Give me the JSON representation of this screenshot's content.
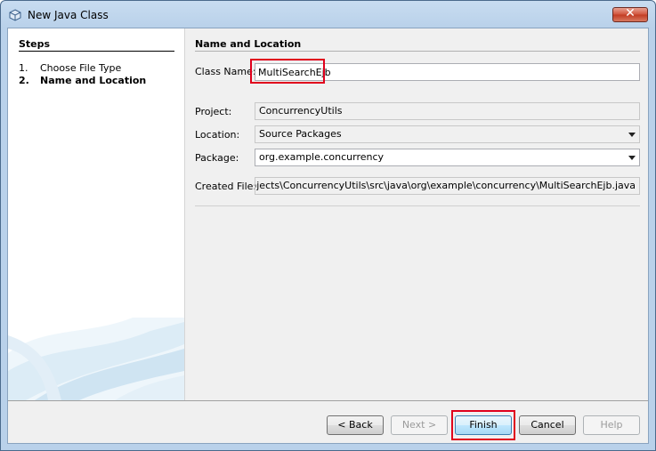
{
  "window": {
    "title": "New Java Class"
  },
  "steps": {
    "title": "Steps",
    "items": [
      {
        "num": "1.",
        "label": "Choose File Type"
      },
      {
        "num": "2.",
        "label": "Name and Location"
      }
    ]
  },
  "panel": {
    "title": "Name and Location",
    "class_name": {
      "label": "Class Name:",
      "value": "MultiSearchEjb"
    },
    "project": {
      "label": "Project:",
      "value": "ConcurrencyUtils"
    },
    "location": {
      "label": "Location:",
      "value": "Source Packages"
    },
    "package": {
      "label": "Package:",
      "value": "org.example.concurrency"
    },
    "created_file": {
      "label": "Created File:",
      "value": "Beans\\Projects\\ConcurrencyUtils\\src\\java\\org\\example\\concurrency\\MultiSearchEjb.java"
    }
  },
  "buttons": {
    "back": "< Back",
    "next": "Next >",
    "finish": "Finish",
    "cancel": "Cancel",
    "help": "Help"
  },
  "colors": {
    "highlight": "#e0001c",
    "title_bar": "#b9d1ea",
    "close_button": "#c23b22"
  },
  "icons": {
    "title": "java-cube-icon",
    "close": "close-icon",
    "dropdown": "chevron-down-icon"
  }
}
